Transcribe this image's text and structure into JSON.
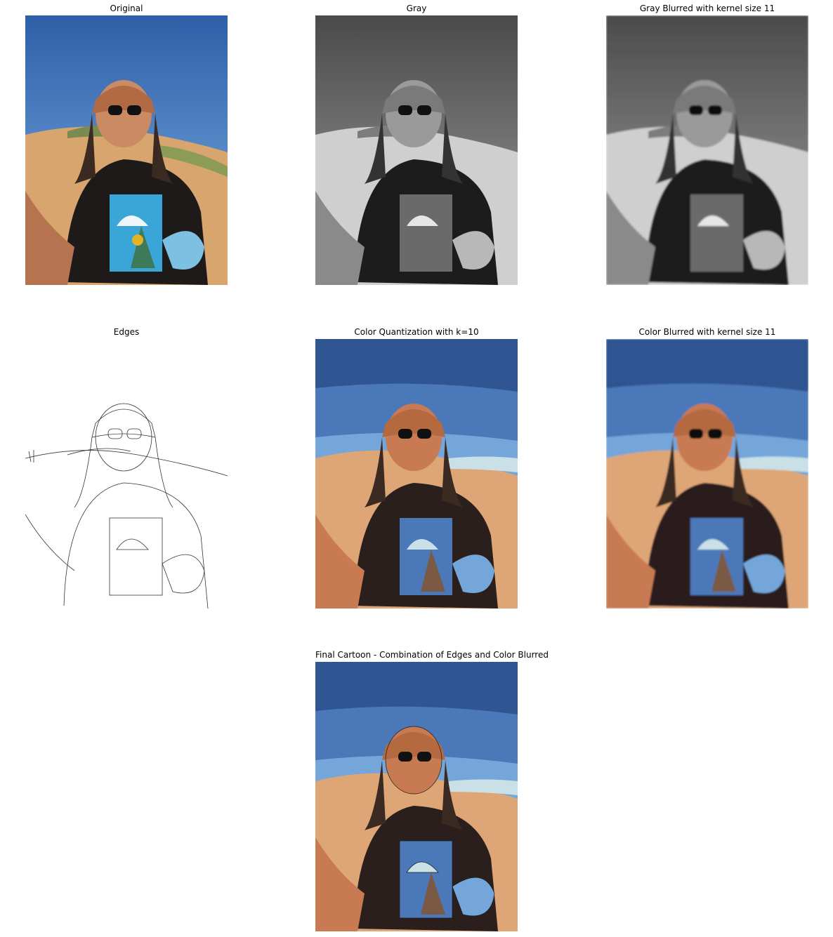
{
  "figure": {
    "panels": [
      {
        "id": "original",
        "title": "Original"
      },
      {
        "id": "gray",
        "title": "Gray"
      },
      {
        "id": "gray-blurred",
        "title": "Gray Blurred with kernel size 11"
      },
      {
        "id": "edges",
        "title": "Edges"
      },
      {
        "id": "color-quantization",
        "title": "Color Quantization with k=10"
      },
      {
        "id": "color-blurred",
        "title": "Color Blurred with kernel size 11"
      },
      {
        "id": "final-cartoon",
        "title": "Final Cartoon - Combination of Edges and Color Blurred"
      }
    ]
  },
  "colors": {
    "sky": "#4a78bd",
    "sand": "#d9a56f",
    "shirt": "#231c1c",
    "skin": "#c07a52",
    "quant_sky_dark": "#2f5592",
    "quant_sky_mid": "#4b78b9",
    "quant_sky_light": "#75a6d9",
    "quant_sand": "#dea677",
    "quant_shirt": "#2a1f1d"
  }
}
